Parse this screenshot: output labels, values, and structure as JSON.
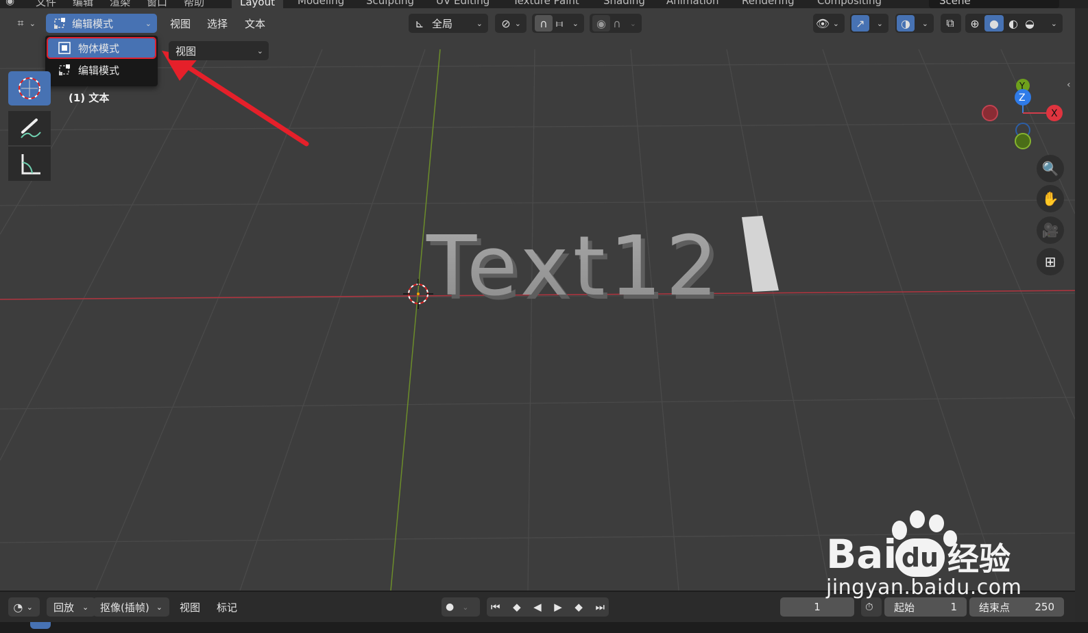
{
  "topbar": {
    "menus": [
      "文件",
      "编辑",
      "渲染",
      "窗口",
      "帮助"
    ],
    "workspaces": [
      "Layout",
      "Modeling",
      "Sculpting",
      "UV Editing",
      "Texture Paint",
      "Shading",
      "Animation",
      "Rendering",
      "Compositing"
    ],
    "active_workspace": "Layout",
    "scene": "Scene"
  },
  "header": {
    "mode_label": "编辑模式",
    "menus": [
      "视图",
      "选择",
      "文本"
    ],
    "orientation": "全局"
  },
  "dropdown": {
    "items": [
      "物体模式",
      "编辑模式"
    ],
    "selected_index": 0
  },
  "view_select": {
    "value": "视图"
  },
  "viewport": {
    "object_label": "(1) 文本",
    "text_object": "Text12",
    "gizmo_axes": [
      "X",
      "Y",
      "Z"
    ]
  },
  "timeline": {
    "playback": "回放",
    "keying": "抠像(插帧)",
    "view": "视图",
    "marker": "标记",
    "current_frame": "1",
    "start_label": "起始",
    "start_value": "1",
    "end_label": "结束点",
    "end_value": "250"
  },
  "watermark": {
    "brand": "Bai",
    "brand_suffix": "经验",
    "url": "jingyan.baidu.com"
  },
  "colors": {
    "accent": "#4772b3",
    "highlight_red": "#e0202e",
    "viewport_bg": "#3d3d3d",
    "panel_bg": "#2b2b2b"
  }
}
